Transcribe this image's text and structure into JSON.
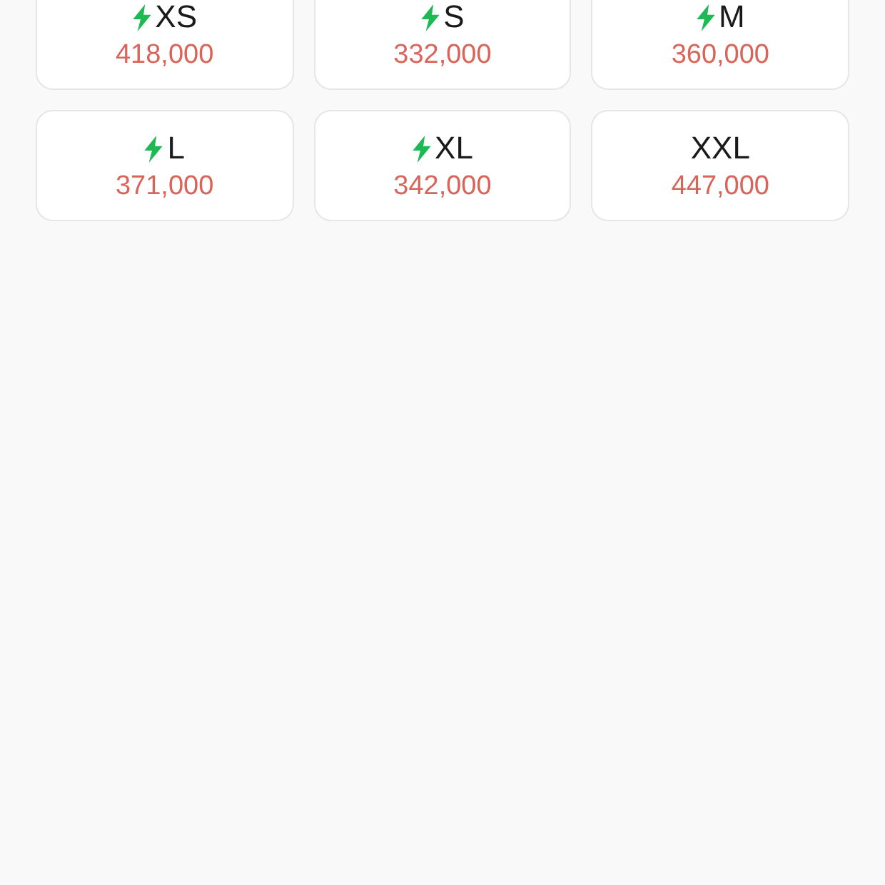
{
  "sizes": [
    {
      "label": "XS",
      "price": "418,000",
      "fast": true
    },
    {
      "label": "S",
      "price": "332,000",
      "fast": true
    },
    {
      "label": "M",
      "price": "360,000",
      "fast": true
    },
    {
      "label": "L",
      "price": "371,000",
      "fast": true
    },
    {
      "label": "XL",
      "price": "342,000",
      "fast": true
    },
    {
      "label": "XXL",
      "price": "447,000",
      "fast": false
    }
  ]
}
